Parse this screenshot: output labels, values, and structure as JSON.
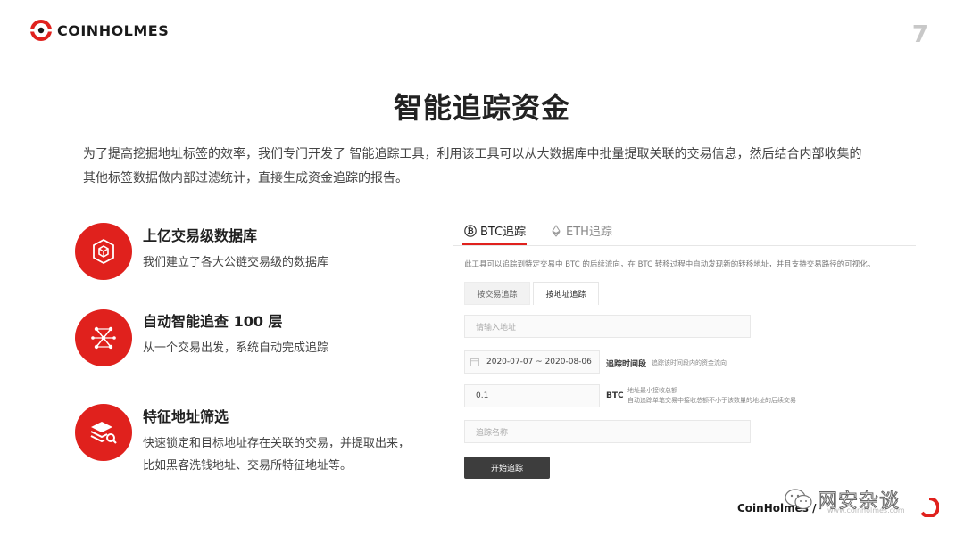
{
  "brand": {
    "name": "COINHOLMES",
    "accent": "#e0211d"
  },
  "page_number": "7",
  "title": "智能追踪资金",
  "intro": "为了提高挖掘地址标签的效率，我们专门开发了 智能追踪工具，利用该工具可以从大数据库中批量提取关联的交易信息，然后结合内部收集的其他标签数据做内部过滤统计，直接生成资金追踪的报告。",
  "features": [
    {
      "title": "上亿交易级数据库",
      "desc": "我们建立了各大公链交易级的数据库",
      "icon": "database-cube-icon"
    },
    {
      "title": "自动智能追查 100 层",
      "desc": "从一个交易出发，系统自动完成追踪",
      "icon": "network-trace-icon"
    },
    {
      "title": "特征地址筛选",
      "desc": "快速锁定和目标地址存在关联的交易，并提取出来，比如黑客洗钱地址、交易所特征地址等。",
      "icon": "layers-search-icon"
    }
  ],
  "panel": {
    "tabs": [
      {
        "label": "BTC追踪",
        "icon": "bitcoin-icon",
        "active": true
      },
      {
        "label": "ETH追踪",
        "icon": "ethereum-icon",
        "active": false
      }
    ],
    "description": "此工具可以追踪到特定交易中 BTC 的后续流向，在 BTC 转移过程中自动发现新的转移地址，并且支持交易路径的可视化。",
    "subtabs": [
      {
        "label": "按交易追踪",
        "active": false
      },
      {
        "label": "按地址追踪",
        "active": true
      }
    ],
    "address_placeholder": "请输入地址",
    "date_range": "2020-07-07  ~ 2020-08-06",
    "date_label": "追踪时间段",
    "date_hint": "追踪该时间段内的资金流向",
    "min_amount": "0.1",
    "min_unit": "BTC",
    "min_hint_title": "地址最小接收总额",
    "min_hint_desc": "自动追踪单笔交易中接收总额不小于该数量的地址的后续交易",
    "name_placeholder": "追踪名称",
    "start_button": "开始追踪"
  },
  "footer": {
    "brand": "CoinHolmes /",
    "url": "www.coinholmes.com",
    "watermark": "网安杂谈"
  }
}
